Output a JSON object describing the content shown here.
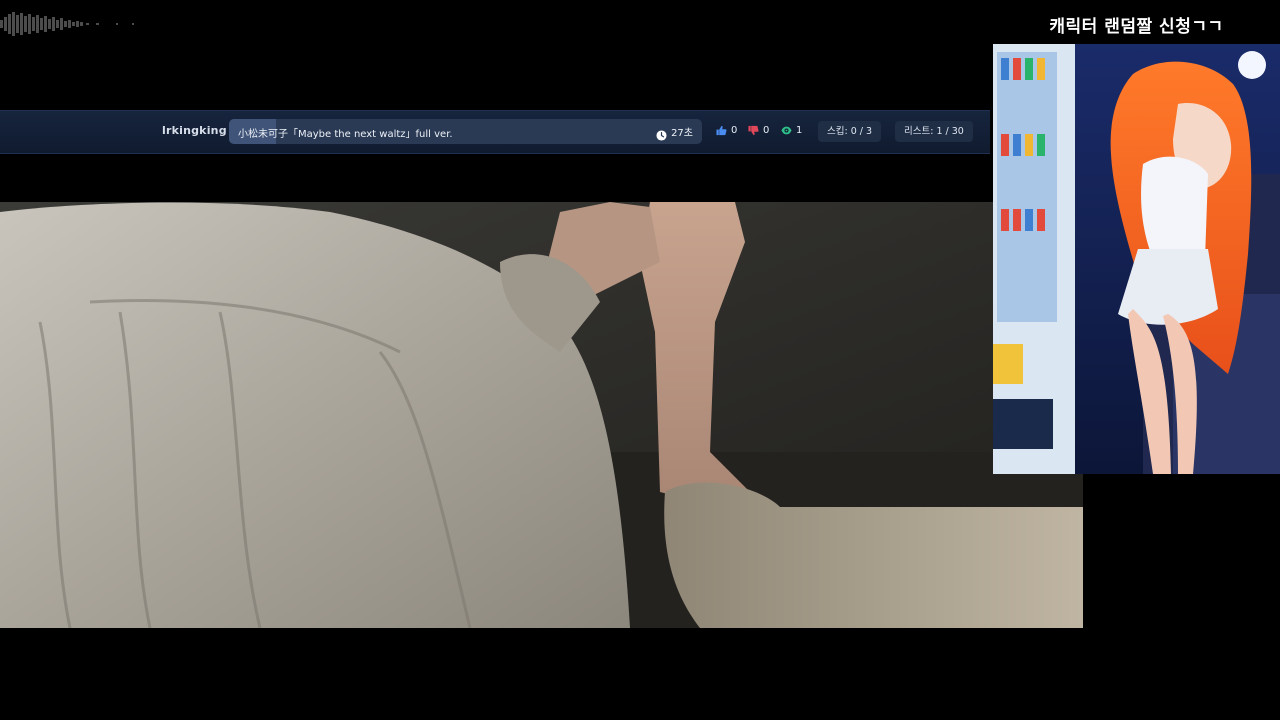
{
  "stream_title": "캐릭터 랜덤짤 신청ㄱㄱ",
  "now_playing": {
    "requester": "lrkingking",
    "song_title": "小松未可子「Maybe the next waltz」full ver.",
    "remaining": "27초",
    "progress": 0.1
  },
  "stats": {
    "likes": "0",
    "dislikes": "0",
    "views": "1"
  },
  "skip_label": "스킵: 0 / 3",
  "list_label": "리스트: 1 / 30",
  "icons": {
    "clock": "clock-icon",
    "like": "thumbs-up-icon",
    "dislike": "thumbs-down-icon",
    "views": "eye-icon"
  },
  "colors": {
    "bar_bg": "#16243d",
    "title_box": "#2a3a55",
    "like": "#4a8cf0",
    "dislike": "#e0475a",
    "views": "#2fc08a"
  }
}
